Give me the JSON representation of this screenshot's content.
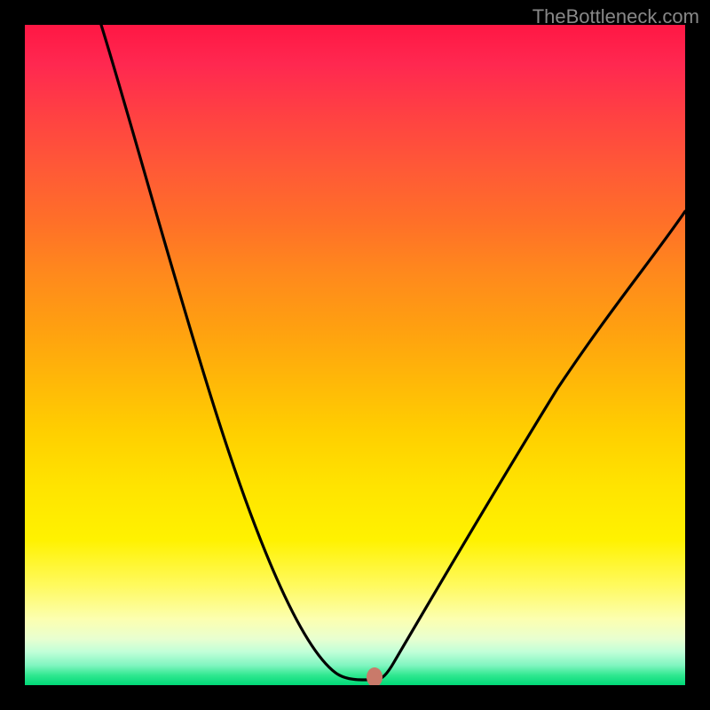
{
  "attribution": "TheBottleneck.com",
  "chart_data": {
    "type": "line",
    "title": "",
    "xlabel": "",
    "ylabel": "",
    "xlim": [
      0,
      100
    ],
    "ylim": [
      0,
      100
    ],
    "curve": {
      "description": "V-shaped bottleneck curve with minimum near x≈52",
      "left_branch_start": {
        "x": 12,
        "y": 100
      },
      "minimum": {
        "x": 52,
        "y": 1
      },
      "right_branch_end": {
        "x": 100,
        "y": 72
      }
    },
    "marker": {
      "x": 52.5,
      "y": 1.5,
      "color": "#c97a6a"
    },
    "background_gradient": {
      "type": "vertical",
      "stops": [
        {
          "pos": 0.0,
          "color": "#ff1744"
        },
        {
          "pos": 0.5,
          "color": "#ffb808"
        },
        {
          "pos": 0.8,
          "color": "#fff200"
        },
        {
          "pos": 1.0,
          "color": "#00d877"
        }
      ]
    }
  }
}
